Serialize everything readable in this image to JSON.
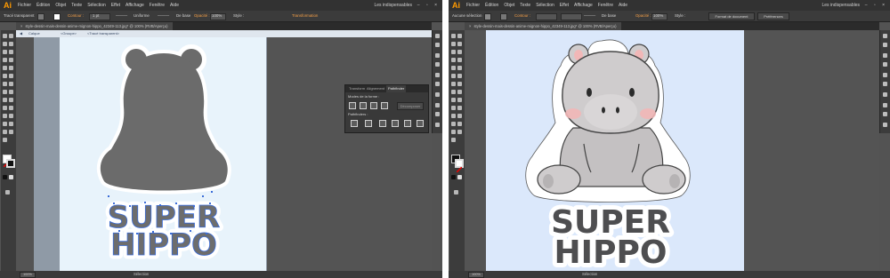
{
  "left": {
    "app_logo": "Ai",
    "menu": [
      "Fichier",
      "Édition",
      "Objet",
      "Texte",
      "Sélection",
      "Effet",
      "Affichage",
      "Fenêtre",
      "Aide"
    ],
    "workspace": "Les indispensables",
    "control_bar": {
      "selection_label": "Tracé transparent",
      "contour_label": "Contour :",
      "stroke_weight": "1 pt",
      "profile": "Uniforme",
      "brush": "De base",
      "opacity_label": "Opacité :",
      "opacity_value": "100%",
      "style_label": "Style :",
      "transform_label": "Transformation"
    },
    "document_tab": "style-dessin-mais-dessin-anime-mignon-hippo_42349-113.jpg* @ 100% (RVB/Aperçu)",
    "path_bar": [
      "Calque",
      "<Groupe>",
      "<Tracé transparent>"
    ],
    "zoom": "100%",
    "status": "Sélection",
    "sticker_text": [
      "SUPER",
      "HIPPO"
    ],
    "pathfinder_panel": {
      "tabs": [
        "Transform",
        "Alignement",
        "Pathfinder"
      ],
      "shape_modes_label": "Modes de la forme :",
      "expand_button": "Décomposer",
      "pathfinders_label": "Pathfinders :"
    }
  },
  "right": {
    "app_logo": "Ai",
    "menu": [
      "Fichier",
      "Édition",
      "Objet",
      "Texte",
      "Sélection",
      "Effet",
      "Affichage",
      "Fenêtre",
      "Aide"
    ],
    "workspace": "Les indispensables",
    "control_bar": {
      "selection_label": "Aucune sélection",
      "contour_label": "Contour :",
      "brush": "De base",
      "opacity_label": "Opacité :",
      "opacity_value": "100%",
      "style_label": "Style :",
      "doc_format_button": "Format de document",
      "preferences_button": "Préférences"
    },
    "document_tab": "style-dessin-mais-dessin-anime-mignon-hippo_42349-113.jpg* @ 100% (RVB/Aperçu)",
    "zoom": "100%",
    "status": "Sélection",
    "sticker_text": [
      "SUPER",
      "HIPPO"
    ]
  },
  "colors": {
    "ui_dark": "#535353",
    "artboard_left": "#e8f3fb",
    "artboard_right": "#dbe8fb",
    "silhouette": "#6b6b6b",
    "sticker_outline": "#ffffff",
    "letters": "#4e4e50",
    "hippo_body": "#cfcccd",
    "blush": "#f1b7b7"
  }
}
